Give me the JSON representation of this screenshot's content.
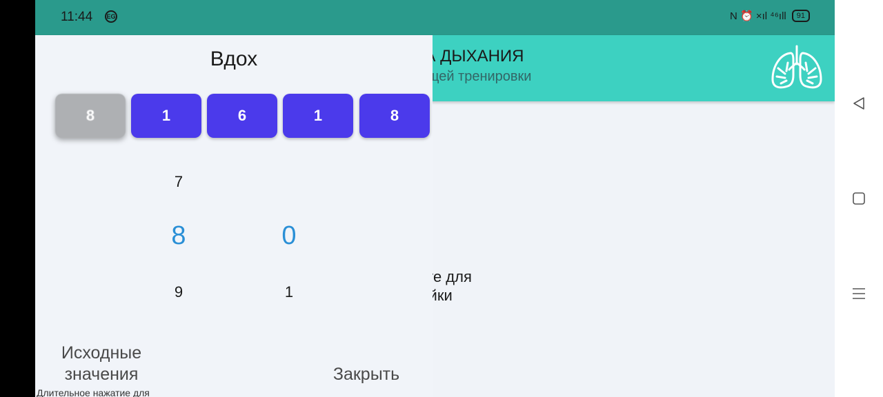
{
  "status_bar": {
    "time": "11:44",
    "eg_badge": "EG",
    "right_icons": "N  ⏰  ×ıl  ⁴⁶ıll",
    "battery": "91"
  },
  "header": {
    "title": "РА ДЫХАНИЯ",
    "subtitle": "кущей тренировки",
    "icon": "lungs-icon"
  },
  "hint": "жмите для\nстройки",
  "panel": {
    "title": "Вдох",
    "digits": [
      "8",
      "1",
      "6",
      "1",
      "8"
    ],
    "picker_col1": {
      "above": "7",
      "selected": "8",
      "below": "9"
    },
    "picker_col2": {
      "above": "",
      "selected": "0",
      "below": "1"
    },
    "reset_label": "Исходные\nзначения",
    "close_label": "Закрыть",
    "note": "Длительное нажатие для"
  },
  "nav": {
    "back": "back-icon",
    "home": "home-icon",
    "menu": "menu-icon"
  },
  "colors": {
    "status_bar": "#2a9a8c",
    "header": "#3dd1c1",
    "digit_active": "#4b3aeb",
    "digit_inactive": "#aeb0b3",
    "picker_selected": "#2a8fd6"
  }
}
